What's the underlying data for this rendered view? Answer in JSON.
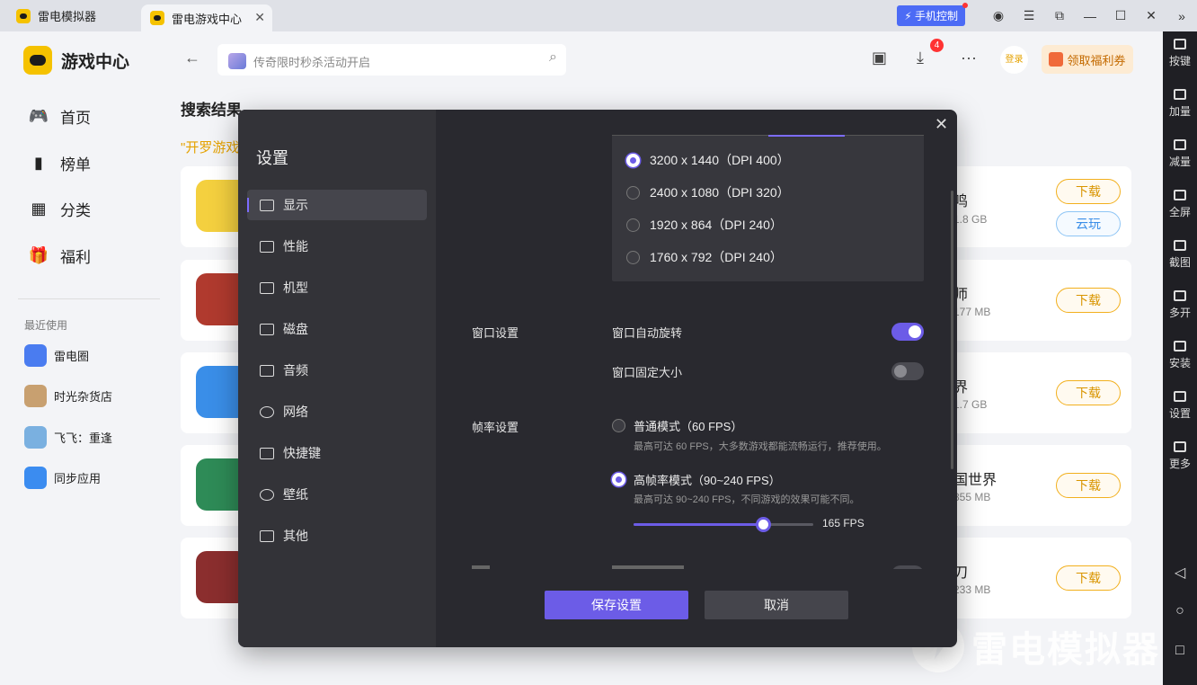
{
  "titlebar": {
    "app_name": "雷电模拟器",
    "active_tab": "雷电游戏中心",
    "phone_control": "手机控制"
  },
  "leftnav": {
    "brand": "游戏中心",
    "items": [
      {
        "label": "首页",
        "icon": "gamepad-icon"
      },
      {
        "label": "榜单",
        "icon": "ranking-icon"
      },
      {
        "label": "分类",
        "icon": "category-icon"
      },
      {
        "label": "福利",
        "icon": "gift-icon"
      }
    ],
    "recent_label": "最近使用",
    "recent": [
      {
        "label": "雷电圈",
        "color": "#4a7cf0"
      },
      {
        "label": "时光杂货店",
        "color": "#c8a070"
      },
      {
        "label": "飞飞：重逢",
        "color": "#7ab0e0"
      },
      {
        "label": "同步应用",
        "color": "#3b8cf0"
      }
    ]
  },
  "header": {
    "search_placeholder": "传奇限时秒杀活动开启",
    "download_badge": "4",
    "login": "登录",
    "coupon": "领取福利券"
  },
  "results": {
    "title": "搜索结果",
    "query": "\"开罗游戏",
    "cards": [
      {
        "name": "鸣",
        "size": "1.8 GB",
        "download": "下载",
        "cloud": "云玩",
        "thumb": "#f4d03f"
      },
      {
        "name": "师",
        "size": "177 MB",
        "download": "下载",
        "thumb": "#b03a2e"
      },
      {
        "name": "界",
        "size": "1.7 GB",
        "download": "下载",
        "thumb": "#3a8ee8"
      },
      {
        "name": "国世界",
        "size": "855 MB",
        "download": "下载",
        "thumb": "#2e8b57"
      },
      {
        "name": "刀",
        "size": "233 MB",
        "download": "下载",
        "thumb": "#8b2e2e"
      }
    ]
  },
  "rightbar": {
    "items": [
      "按键",
      "加量",
      "减量",
      "全屏",
      "截图",
      "多开",
      "安装",
      "设置",
      "更多"
    ]
  },
  "watermark": "雷电模拟器",
  "settings": {
    "title": "设置",
    "nav": [
      "显示",
      "性能",
      "机型",
      "磁盘",
      "音频",
      "网络",
      "快捷键",
      "壁纸",
      "其他"
    ],
    "resolutions": [
      {
        "label": "3200 x 1440（DPI 400）",
        "selected": true
      },
      {
        "label": "2400 x 1080（DPI 320）",
        "selected": false
      },
      {
        "label": "1920 x 864（DPI 240）",
        "selected": false
      },
      {
        "label": "1760 x 792（DPI 240）",
        "selected": false
      }
    ],
    "window_section": "窗口设置",
    "auto_rotate": "窗口自动旋转",
    "auto_rotate_on": true,
    "fixed_size": "窗口固定大小",
    "fixed_size_on": false,
    "fps_section": "帧率设置",
    "fps_normal": "普通模式（60 FPS）",
    "fps_normal_hint": "最高可达 60 FPS，大多数游戏都能流畅运行，推荐使用。",
    "fps_high": "高帧率模式（90~240 FPS）",
    "fps_high_hint": "最高可达 90~240 FPS，不同游戏的效果可能不同。",
    "fps_value": "165 FPS",
    "fps_fraction": 0.72,
    "save": "保存设置",
    "cancel": "取消"
  }
}
